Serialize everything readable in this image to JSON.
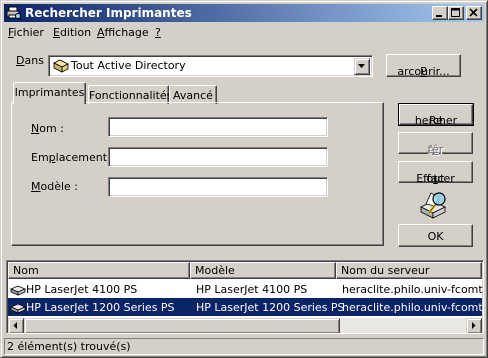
{
  "window": {
    "title": "Rechercher Imprimantes"
  },
  "menu": {
    "fichier": {
      "mnemonic": "F",
      "rest": "ichier"
    },
    "edition": {
      "mnemonic": "E",
      "rest": "dition"
    },
    "affichage": {
      "mnemonic": "A",
      "rest": "ffichage"
    },
    "help": {
      "mnemonic": "?"
    }
  },
  "scope": {
    "label_mnemonic": "D",
    "label_rest": "ans :",
    "selected": "Tout Active Directory",
    "icon": "directory-icon",
    "browse_mnemonic": "P",
    "browse_rest": "arcourir..."
  },
  "tabs": [
    {
      "label": "Imprimantes",
      "active": true
    },
    {
      "label": "Fonctionnalités",
      "active": false
    },
    {
      "label": "Avancé",
      "active": false
    }
  ],
  "fields": {
    "nom": {
      "mnemonic": "N",
      "rest": "om :",
      "value": ""
    },
    "emplacement": {
      "before": "Em",
      "mnemonic": "p",
      "rest": "lacement :",
      "value": ""
    },
    "modele": {
      "mnemonic": "M",
      "rest": "odèle :",
      "value": ""
    }
  },
  "actions": {
    "search": {
      "before": "Re",
      "mnemonic": "c",
      "rest": "hercher"
    },
    "stop": {
      "before": "Arr",
      "mnemonic": "ê",
      "rest": "ter",
      "disabled": true
    },
    "clear": {
      "before": "Effacer ",
      "mnemonic": "t",
      "rest": "out"
    },
    "ok": "OK",
    "search_illustration": "magnifying-glass-printer-icon"
  },
  "results": {
    "columns": [
      "Nom",
      "Modèle",
      "Nom du serveur"
    ],
    "rows": [
      {
        "name": "HP LaserJet 4100 PS",
        "model": "HP LaserJet 4100 PS",
        "server": "heraclite.philo.univ-fcomte.fr",
        "selected": false
      },
      {
        "name": "HP LaserJet 1200 Series PS",
        "model": "HP LaserJet 1200 Series PS",
        "server": "heraclite.philo.univ-fcomte.fr",
        "selected": true
      }
    ]
  },
  "status": "2 élément(s) trouvé(s)",
  "colors": {
    "titlebar": "#0a246a",
    "titlebar_end": "#a6caf0",
    "face": "#d4d0c8",
    "selection": "#0a246a"
  }
}
